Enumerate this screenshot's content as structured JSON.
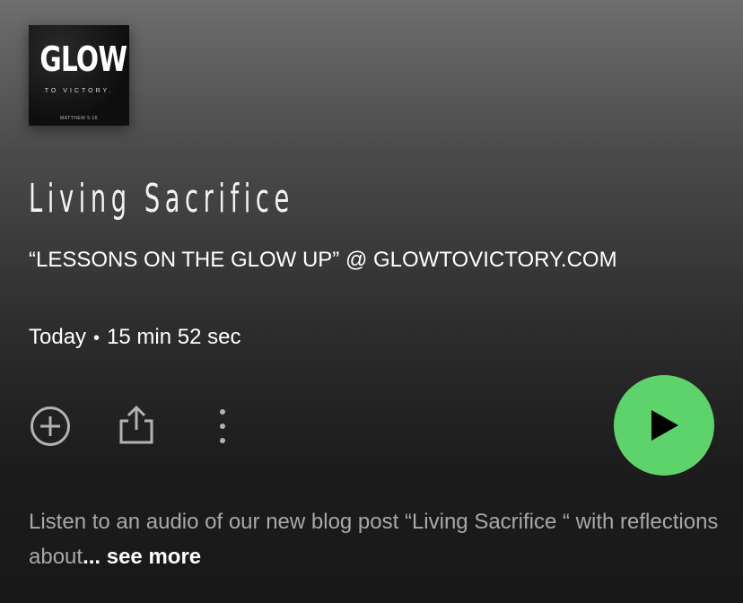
{
  "episode": {
    "cover": {
      "title": "GLOW",
      "subtitle": "TO VICTORY.",
      "verse": "MATTHEW 5:16"
    },
    "title": "Living Sacrifice",
    "show": "“LESSONS ON THE GLOW UP” @ GLOWTOVICTORY.COM",
    "date": "Today",
    "separator": "•",
    "duration": "15 min 52 sec",
    "description": "Listen to an audio of our new blog post “Living Sacrifice “ with reflections about",
    "see_more": "... see more"
  },
  "actions": {
    "add_icon": "plus-circle-icon",
    "share_icon": "share-icon",
    "more_icon": "more-vertical-icon",
    "play_icon": "play-icon"
  },
  "colors": {
    "play_button": "#5fd36b"
  }
}
